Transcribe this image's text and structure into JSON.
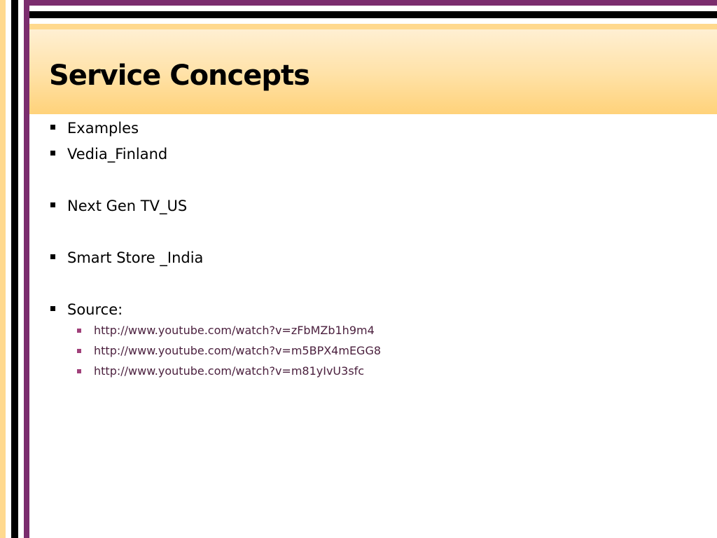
{
  "slide": {
    "title": "Service Concepts",
    "bullets": [
      "Examples",
      "Vedia_Finland",
      "Next Gen TV_US",
      "Smart Store _India",
      "Source:"
    ],
    "links": [
      "http://www.youtube.com/watch?v=zFbMZb1h9m4",
      "http://www.youtube.com/watch?v=m5BPX4mEGG8",
      "http://www.youtube.com/watch?v=m81yIvU3sfc"
    ]
  },
  "colors": {
    "accent_purple": "#7b2d6e",
    "title_band": "#ffd98e",
    "link_text": "#4a1f3d",
    "sub_bullet": "#a0407a"
  }
}
